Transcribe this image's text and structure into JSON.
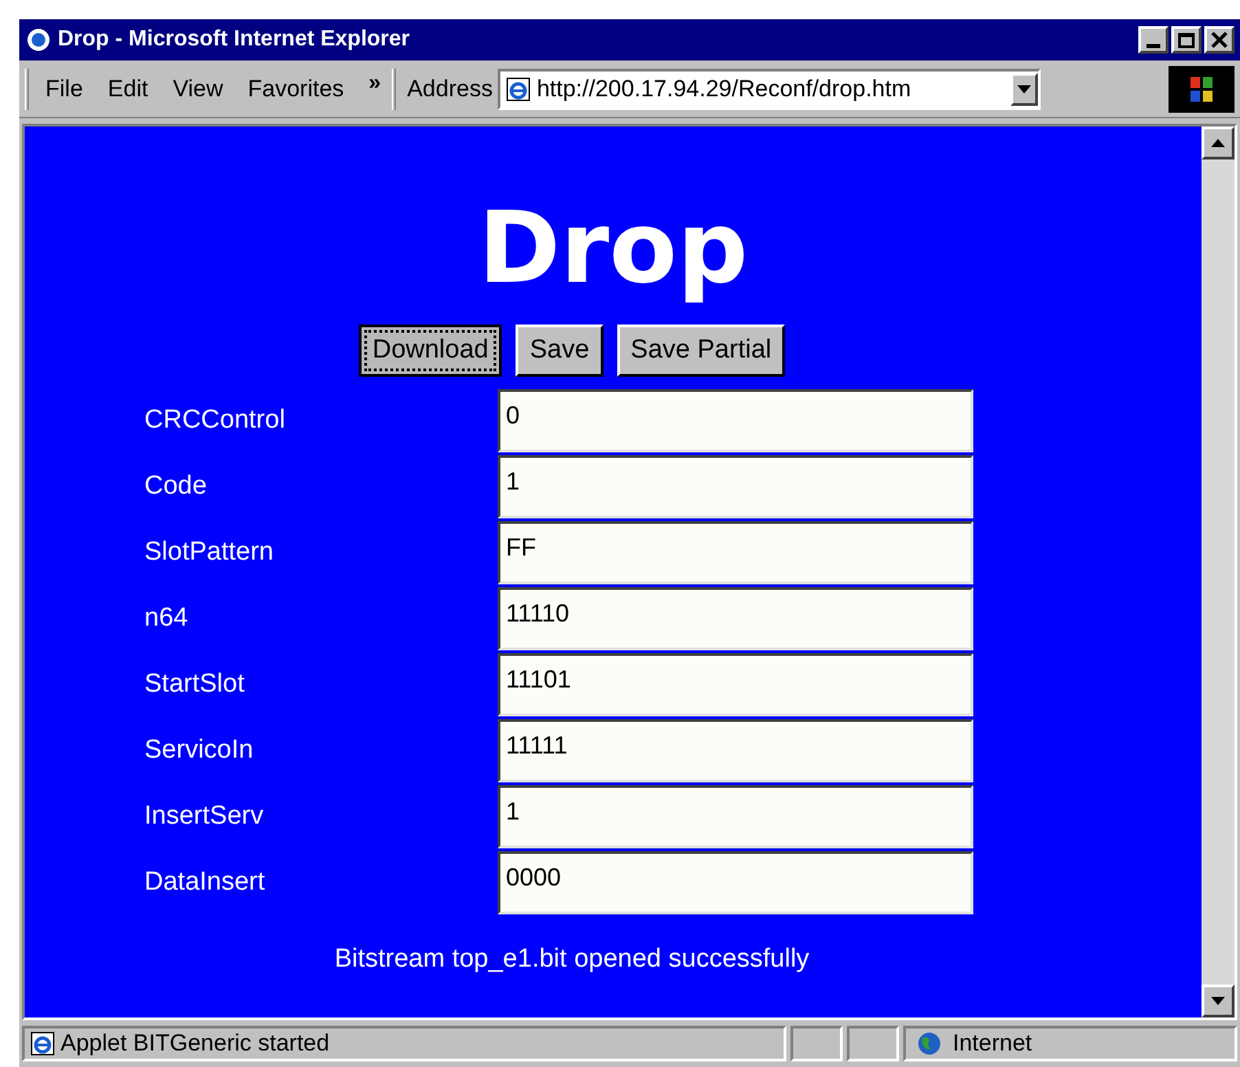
{
  "window": {
    "title": "Drop - Microsoft Internet Explorer"
  },
  "menu": [
    "File",
    "Edit",
    "View",
    "Favorites"
  ],
  "more": "»",
  "address": {
    "label": "Address",
    "value": "http://200.17.94.29/Reconf/drop.htm"
  },
  "page": {
    "heading": "Drop",
    "buttons": [
      {
        "label": "Download",
        "focused": true
      },
      {
        "label": "Save",
        "focused": false
      },
      {
        "label": "Save Partial",
        "focused": false
      }
    ],
    "fields": [
      {
        "label": "CRCControl",
        "value": "0"
      },
      {
        "label": "Code",
        "value": "1"
      },
      {
        "label": "SlotPattern",
        "value": "FF"
      },
      {
        "label": "n64",
        "value": "11110"
      },
      {
        "label": "StartSlot",
        "value": "11101"
      },
      {
        "label": "ServicoIn",
        "value": "11111"
      },
      {
        "label": "InsertServ",
        "value": "1"
      },
      {
        "label": "DataInsert",
        "value": "0000"
      }
    ],
    "message": "Bitstream top_e1.bit opened successfully"
  },
  "status_bar": {
    "text": "Applet BITGeneric started",
    "zone": "Internet"
  }
}
